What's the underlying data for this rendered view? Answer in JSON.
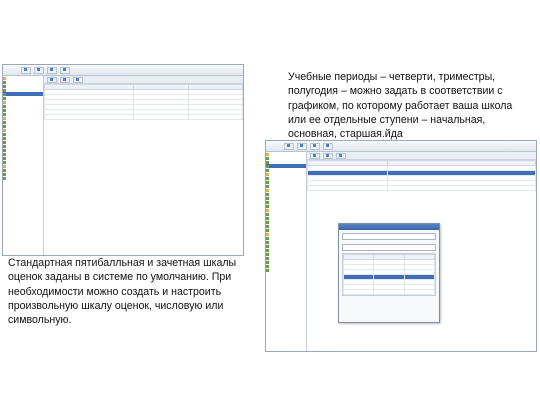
{
  "captions": {
    "top": "Учебные периоды – четверти, триместры, полугодия – можно задать в соответствии с графиком, по которому работает ваша школа или ее отдельные ступени – начальная, основная, старшая.йда",
    "bottom": "Стандартная пятибалльная и зачетная шкалы оценок заданы в системе по умолчанию. При необходимости можно создать и настроить произвольную шкалу оценок, числовую или символьную."
  }
}
